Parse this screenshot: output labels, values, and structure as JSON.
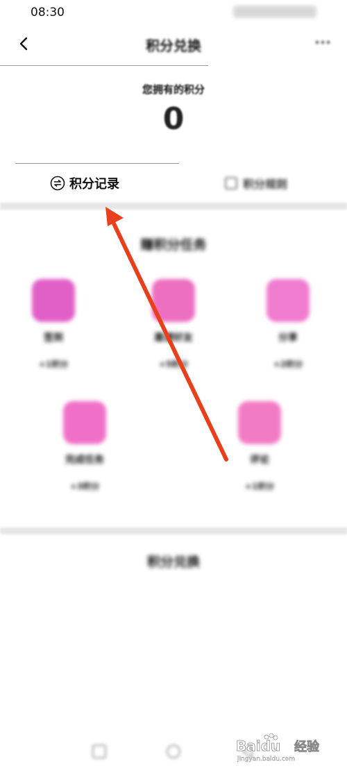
{
  "status_bar": {
    "time": "08:30"
  },
  "header": {
    "title": "积分兑换"
  },
  "points": {
    "label": "您拥有的积分",
    "value": "0"
  },
  "tabs": [
    {
      "label": "积分记录"
    },
    {
      "label": "积分规则"
    }
  ],
  "earn_section": {
    "title": "赚积分任务",
    "tasks": [
      {
        "name": "签到",
        "reward": "+1积分",
        "icon": "gift-icon",
        "color": "#e060c8"
      },
      {
        "name": "邀请好友",
        "reward": "+5积分",
        "icon": "pen-icon",
        "color": "#ec6fc0"
      },
      {
        "name": "分享",
        "reward": "+2积分",
        "icon": "document-icon",
        "color": "#f07ccf"
      },
      {
        "name": "完成任务",
        "reward": "+3积分",
        "icon": "checklist-icon",
        "color": "#f070c8"
      },
      {
        "name": "评论",
        "reward": "+1积分",
        "icon": "edit-icon",
        "color": "#f27cc4"
      }
    ]
  },
  "redeem_section": {
    "title": "积分兑换"
  },
  "watermark": {
    "brand": "Baidu",
    "suffix": "经验",
    "url": "jingyan.baidu.com"
  },
  "colors": {
    "arrow": "#e8401c",
    "accent_pink": "#ec6fc0"
  }
}
